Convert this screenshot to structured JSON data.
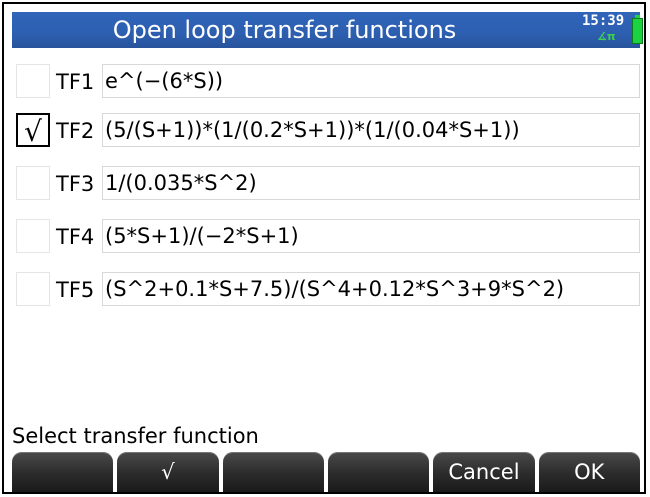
{
  "title": "Open loop transfer functions",
  "status": {
    "time": "15:39",
    "angle_mode": "∡π"
  },
  "rows": [
    {
      "label": "TF1",
      "expr": "e^(−(6*S))",
      "checked": false
    },
    {
      "label": "TF2",
      "expr": "(5/(S+1))*(1/(0.2*S+1))*(1/(0.04*S+1))",
      "checked": true
    },
    {
      "label": "TF3",
      "expr": "1/(0.035*S^2)",
      "checked": false
    },
    {
      "label": "TF4",
      "expr": "(5*S+1)/(−2*S+1)",
      "checked": false
    },
    {
      "label": "TF5",
      "expr": "(S^2+0.1*S+7.5)/(S^4+0.12*S^3+9*S^2)",
      "checked": false
    }
  ],
  "check_mark": "√",
  "prompt": "Select transfer function",
  "menu": [
    "",
    "√",
    "",
    "",
    "Cancel",
    "OK"
  ]
}
